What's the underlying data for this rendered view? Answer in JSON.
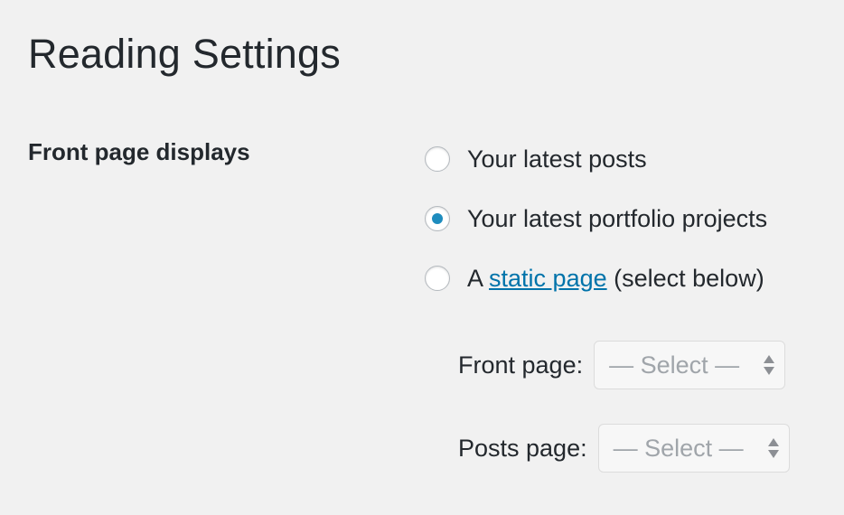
{
  "page": {
    "title": "Reading Settings"
  },
  "front_page_displays": {
    "label": "Front page displays",
    "options": [
      {
        "label": "Your latest posts",
        "checked": false
      },
      {
        "label": "Your latest portfolio projects",
        "checked": true
      },
      {
        "prefix": "A ",
        "link_text": "static page",
        "suffix": " (select below)",
        "checked": false
      }
    ]
  },
  "selects": {
    "front_page": {
      "label": "Front page:",
      "value": "— Select —"
    },
    "posts_page": {
      "label": "Posts page:",
      "value": "— Select —"
    }
  },
  "colors": {
    "background": "#f1f1f1",
    "accent": "#1e8cbe",
    "link": "#0073aa"
  }
}
